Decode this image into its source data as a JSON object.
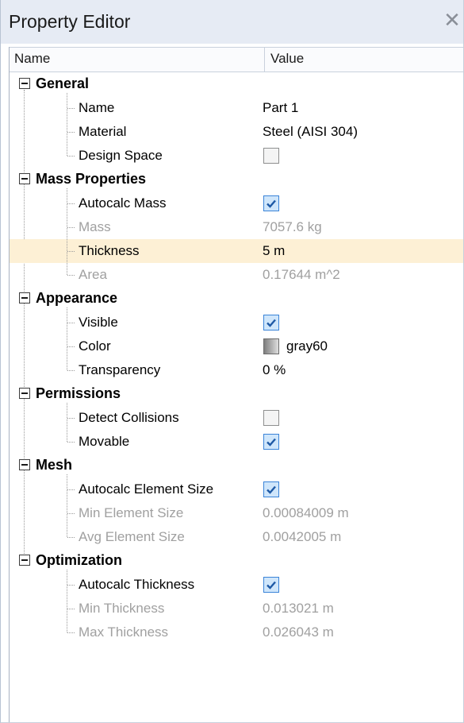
{
  "window": {
    "title": "Property Editor",
    "close_glyph": "✕"
  },
  "columns": {
    "name": "Name",
    "value": "Value"
  },
  "categories": [
    {
      "label": "General",
      "props": [
        {
          "label": "Name",
          "value": "Part 1",
          "enabled": true
        },
        {
          "label": "Material",
          "value": "Steel (AISI 304)",
          "enabled": true
        },
        {
          "label": "Design Space",
          "checkbox": false,
          "enabled": true
        }
      ]
    },
    {
      "label": "Mass Properties",
      "props": [
        {
          "label": "Autocalc Mass",
          "checkbox": true,
          "enabled": true
        },
        {
          "label": "Mass",
          "value": "7057.6 kg",
          "enabled": false
        },
        {
          "label": "Thickness",
          "value": "5 m",
          "enabled": true,
          "selected": true
        },
        {
          "label": "Area",
          "value": "0.17644 m^2",
          "enabled": false
        }
      ]
    },
    {
      "label": "Appearance",
      "props": [
        {
          "label": "Visible",
          "checkbox": true,
          "enabled": true
        },
        {
          "label": "Color",
          "value": "gray60",
          "swatch": true,
          "enabled": true
        },
        {
          "label": "Transparency",
          "value": "0 %",
          "enabled": true
        }
      ]
    },
    {
      "label": "Permissions",
      "props": [
        {
          "label": "Detect Collisions",
          "checkbox": false,
          "enabled": true
        },
        {
          "label": "Movable",
          "checkbox": true,
          "enabled": true
        }
      ]
    },
    {
      "label": "Mesh",
      "props": [
        {
          "label": "Autocalc Element Size",
          "checkbox": true,
          "enabled": true
        },
        {
          "label": "Min Element Size",
          "value": "0.00084009 m",
          "enabled": false
        },
        {
          "label": "Avg Element Size",
          "value": "0.0042005 m",
          "enabled": false
        }
      ]
    },
    {
      "label": "Optimization",
      "props": [
        {
          "label": "Autocalc Thickness",
          "checkbox": true,
          "enabled": true
        },
        {
          "label": "Min Thickness",
          "value": "0.013021 m",
          "enabled": false
        },
        {
          "label": "Max Thickness",
          "value": "0.026043 m",
          "enabled": false
        }
      ]
    }
  ]
}
